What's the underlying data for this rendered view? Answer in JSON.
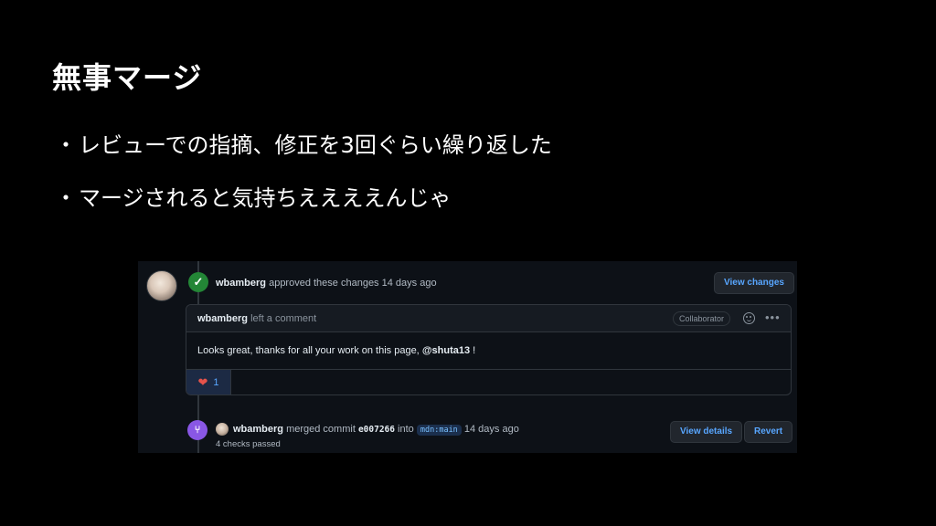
{
  "slide": {
    "title": "無事マージ",
    "bullets": [
      {
        "dot": "・",
        "text": "レビューでの指摘、修正を3回ぐらい繰り返した"
      },
      {
        "dot": "・",
        "text": "マージされると気持ちええええんじゃ"
      }
    ]
  },
  "screenshot": {
    "review": {
      "reviewer": "wbamberg",
      "action": "approved these changes",
      "time": "14 days ago",
      "view_changes_label": "View changes"
    },
    "comment": {
      "author": "wbamberg",
      "action": "left a comment",
      "role_badge": "Collaborator",
      "body_prefix": "Looks great, thanks for all your work on this page, ",
      "mention": "@shuta13",
      "body_suffix": " !",
      "reaction_emoji": "❤",
      "reaction_count": "1",
      "more_label": "•••"
    },
    "merge": {
      "user": "wbamberg",
      "action": "merged commit",
      "commit": "e007266",
      "into": "into",
      "branch": "mdn:main",
      "time": "14 days ago",
      "checks": "4 checks passed",
      "view_details_label": "View details",
      "revert_label": "Revert"
    },
    "colors": {
      "approved": "#238636",
      "merged": "#8957e5",
      "link": "#58a6ff"
    },
    "icons": {
      "approved": "check-icon",
      "merged": "merge-icon",
      "options": "kebab-icon",
      "reaction": "heart-icon"
    }
  }
}
